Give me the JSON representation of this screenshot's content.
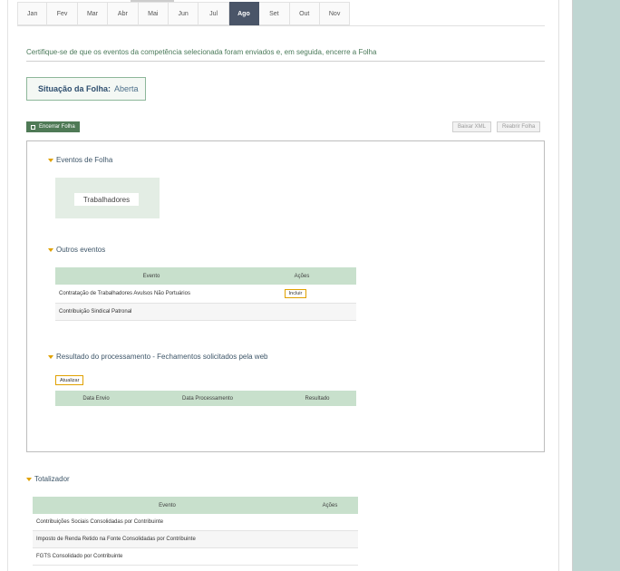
{
  "months": [
    {
      "label": "Jan",
      "active": false
    },
    {
      "label": "Fev",
      "active": false
    },
    {
      "label": "Mar",
      "active": false
    },
    {
      "label": "Abr",
      "active": false
    },
    {
      "label": "Mai",
      "active": false
    },
    {
      "label": "Jun",
      "active": false
    },
    {
      "label": "Jul",
      "active": false
    },
    {
      "label": "Ago",
      "active": true
    },
    {
      "label": "Set",
      "active": false
    },
    {
      "label": "Out",
      "active": false
    },
    {
      "label": "Nov",
      "active": false
    }
  ],
  "instruction": "Certifique-se de que os eventos da competência selecionada foram enviados e, em seguida, encerre a Folha",
  "situacao": {
    "label": "Situação da Folha:",
    "value": "Aberta"
  },
  "buttons": {
    "encerrar": "Encerrar Folha",
    "baixar_xml": "Baixar XML",
    "reabrir": "Reabrir Folha"
  },
  "eventos_folha": {
    "title": "Eventos de Folha",
    "trabalhadores": "Trabalhadores"
  },
  "outros_eventos": {
    "title": "Outros eventos",
    "headers": [
      "Evento",
      "Ações"
    ],
    "rows": [
      {
        "evento": "Contratação de Trabalhadores Avulsos Não Portuários",
        "acao": "Incluir"
      },
      {
        "evento": "Contribuição Sindical Patronal",
        "acao": ""
      }
    ]
  },
  "resultado": {
    "title": "Resultado do processamento - Fechamentos solicitados pela web",
    "atualizar": "Atualizar",
    "headers": [
      "Data Envio",
      "Data Processamento",
      "Resultado"
    ]
  },
  "totalizador": {
    "title": "Totalizador",
    "headers": [
      "Evento",
      "Ações"
    ],
    "rows": [
      "Contribuições Sociais Consolidadas por Contribuinte",
      "Imposto de Renda Retido na Fonte Consolidadas por Contribuinte",
      "FGTS Consolidado por Contribuinte"
    ]
  },
  "colors": {
    "accent_green": "#4f7a56",
    "header_green": "#c8e0cc",
    "active_tab": "#4a5568",
    "triangle": "#e0a100",
    "side_panel": "#bfd6d2"
  }
}
